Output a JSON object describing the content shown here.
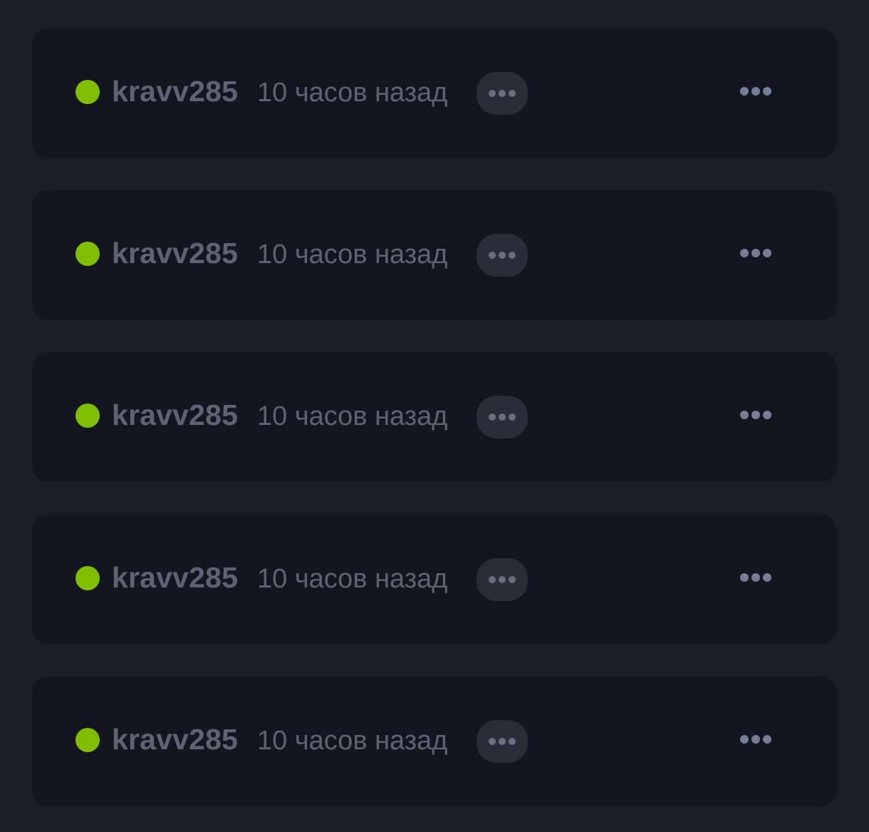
{
  "colors": {
    "background": "#1b1d27",
    "card": "#14161f",
    "online_status": "#7fbf00",
    "text_muted": "#5e6273",
    "pill_button": "#2a2c38",
    "dots": "#777c97"
  },
  "icons": {
    "status": "online-dot-icon",
    "reply": "ellipsis-icon",
    "menu": "more-horizontal-icon"
  },
  "entries": [
    {
      "username": "kravv285",
      "time": "10 часов назад"
    },
    {
      "username": "kravv285",
      "time": "10 часов назад"
    },
    {
      "username": "kravv285",
      "time": "10 часов назад"
    },
    {
      "username": "kravv285",
      "time": "10 часов назад"
    },
    {
      "username": "kravv285",
      "time": "10 часов назад"
    }
  ]
}
